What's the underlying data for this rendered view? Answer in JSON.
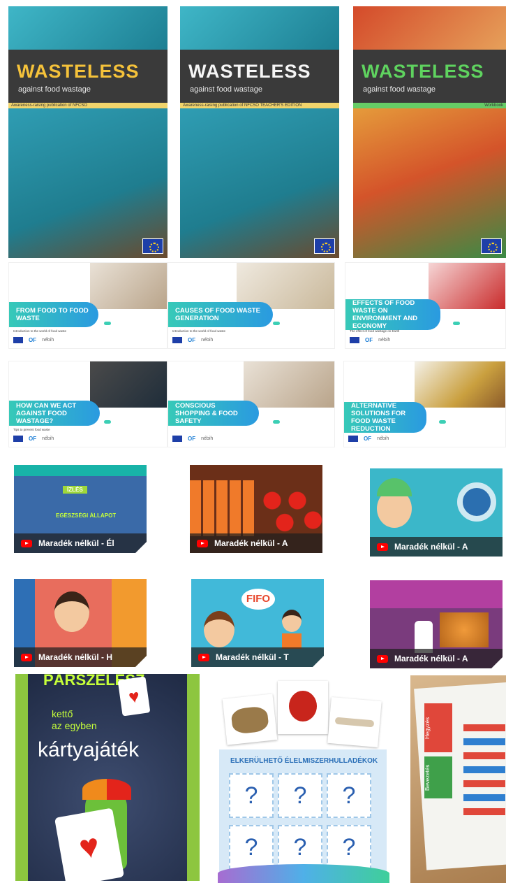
{
  "books": [
    {
      "title": "WASTELESS",
      "subtitle": "against food wastage",
      "strip": "Awareness-raising publication of NFCSO",
      "title_color": "#f5c23a",
      "strip_color": "#f1d46b"
    },
    {
      "title": "WASTELESS",
      "subtitle": "against food wastage",
      "strip": "Awareness-raising publication of NFCSO     TEACHER'S EDITION",
      "title_color": "#f5f5f5",
      "strip_color": "#f1d46b"
    },
    {
      "title": "WASTELESS",
      "subtitle": "against food wastage",
      "strip": "Workbook",
      "title_color": "#5fd35f",
      "strip_color": "#66cc66"
    }
  ],
  "slides": [
    {
      "label": "FROM FOOD TO FOOD WASTE",
      "intro": "Introduction to the world of food waste"
    },
    {
      "label": "CAUSES OF FOOD WASTE GENERATION",
      "intro": "Introduction to the world of food waste"
    },
    {
      "label": "EFFECTS OF FOOD WASTE ON ENVIRONMENT AND ECONOMY",
      "intro": "The effect of food wastage on Earth"
    },
    {
      "label": "HOW CAN WE ACT AGAINST FOOD WASTAGE?",
      "intro": "Tips to prevent food waste"
    },
    {
      "label": "CONSCIOUS SHOPPING & FOOD SAFETY",
      "intro": ""
    },
    {
      "label": "ALTERNATIVE SOLUTIONS FOR FOOD WASTE REDUCTION",
      "intro": ""
    }
  ],
  "slide_logos": {
    "of": "OF",
    "nebih": "nébih"
  },
  "videos": [
    {
      "title": "Maradék nélkül - Él",
      "bg": "#3a6aa8",
      "overlay1": "ÍZLÉS",
      "overlay2": "EGÉSZSÉGI ÁLLAPOT"
    },
    {
      "title": "Maradék nélkül - A",
      "bg": "#6b2f18"
    },
    {
      "title": "Maradék nélkül - A",
      "bg": "#3bb7c9"
    },
    {
      "title": "Maradék nélkül - H",
      "bg": "#f29a2e"
    },
    {
      "title": "Maradék nélkül - T",
      "bg": "#41b9d9",
      "overlay1": "FIFO"
    },
    {
      "title": "Maradék nélkül - A",
      "bg": "#7a3b7d"
    }
  ],
  "cardgame": {
    "head": "PÁRSZELÉSZ",
    "line1": "kettő",
    "line2": "az egyben",
    "title": "kártyajáték"
  },
  "memory": {
    "head": "ELKERÜLHETŐ ÉLELMISZERHULLADÉKOK",
    "mark": "?"
  },
  "board": {
    "label1": "Hegyzés",
    "label2": "Bevezetés"
  }
}
